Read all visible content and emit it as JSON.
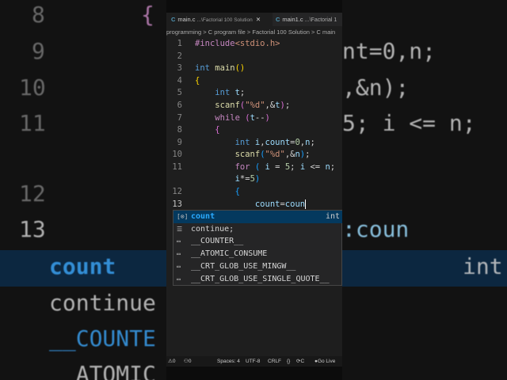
{
  "tabs": [
    {
      "icon": "C",
      "name": "main.c",
      "path": "...\\Factorial 100 Solution",
      "close": "✕"
    },
    {
      "icon": "C",
      "name": "main1.c",
      "path": "...\\Factorial 1"
    }
  ],
  "breadcrumb": "programming > C program file > Factorial 100 Solution > C main",
  "line_numbers": [
    "1",
    "2",
    "3",
    "4",
    "5",
    "6",
    "7",
    "8",
    "9",
    "10",
    "11",
    "",
    "12",
    "13"
  ],
  "suggestions": [
    {
      "label": "count",
      "type": "int",
      "icon": "variable-icon"
    },
    {
      "label": "continue;",
      "icon": "snippet-icon"
    },
    {
      "label": "__COUNTER__",
      "icon": "macro-icon"
    },
    {
      "label": "__ATOMIC_CONSUME",
      "icon": "macro-icon"
    },
    {
      "label": "__CRT_GLOB_USE_MINGW__",
      "icon": "macro-icon"
    },
    {
      "label": "__CRT_GLOB_USE_SINGLE_QUOTE__",
      "icon": "macro-icon"
    }
  ],
  "status": {
    "errors": "0",
    "warnings": "0",
    "spaces": "Spaces: 4",
    "encoding": "UTF-8",
    "eol": "CRLF",
    "braces": "{}",
    "lang": "C",
    "golive": "Go Live"
  },
  "bg_left": [
    "8",
    "9",
    "10",
    "11",
    "12",
    "13",
    "count",
    "continue",
    "__COUNTE",
    "__ATOMIC",
    "{"
  ],
  "bg_right": [
    "nt=0,n;",
    ",&n);",
    "5; i <= n;",
    ":coun",
    "int"
  ]
}
